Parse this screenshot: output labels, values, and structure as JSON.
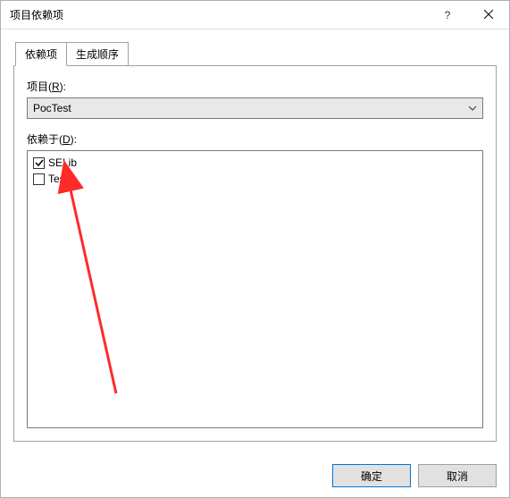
{
  "titlebar": {
    "title": "项目依赖项"
  },
  "tabs": [
    {
      "id": "deps",
      "label": "依赖项",
      "active": true
    },
    {
      "id": "order",
      "label": "生成顺序",
      "active": false
    }
  ],
  "project": {
    "label_prefix": "项目(",
    "label_hotkey": "R",
    "label_suffix": "):",
    "selected": "PocTest"
  },
  "depends": {
    "label_prefix": "依赖于(",
    "label_hotkey": "D",
    "label_suffix": "):",
    "items": [
      {
        "label": "SELib",
        "checked": true
      },
      {
        "label": "Test",
        "checked": false
      }
    ]
  },
  "buttons": {
    "ok": "确定",
    "cancel": "取消"
  }
}
